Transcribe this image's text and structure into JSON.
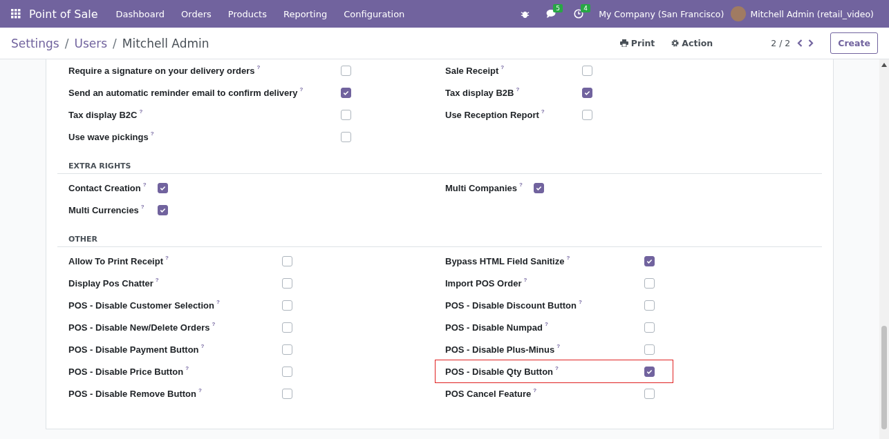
{
  "navbar": {
    "app_name": "Point of Sale",
    "menu": [
      "Dashboard",
      "Orders",
      "Products",
      "Reporting",
      "Configuration"
    ],
    "messages_count": "5",
    "activities_count": "4",
    "company": "My Company (San Francisco)",
    "user": "Mitchell Admin (retail_video)"
  },
  "control_panel": {
    "breadcrumbs": [
      "Settings",
      "Users",
      "Mitchell Admin"
    ],
    "separator": "/",
    "print": "Print",
    "action": "Action",
    "pager": "2 / 2",
    "create": "Create"
  },
  "sections": [
    {
      "left": [
        {
          "label": "Require a signature on your delivery orders",
          "checked": false,
          "highlighted": false
        },
        {
          "label": "Send an automatic reminder email to confirm delivery",
          "checked": true,
          "highlighted": false
        },
        {
          "label": "Tax display B2C",
          "checked": false,
          "highlighted": false
        },
        {
          "label": "Use wave pickings",
          "checked": false,
          "highlighted": false
        }
      ],
      "right": [
        {
          "label": "Sale Receipt",
          "checked": false,
          "highlighted": false
        },
        {
          "label": "Tax display B2B",
          "checked": true,
          "highlighted": false
        },
        {
          "label": "Use Reception Report",
          "checked": false,
          "highlighted": false
        }
      ]
    },
    {
      "title": "EXTRA RIGHTS",
      "left": [
        {
          "label": "Contact Creation",
          "checked": true,
          "highlighted": false
        },
        {
          "label": "Multi Currencies",
          "checked": true,
          "highlighted": false
        }
      ],
      "right": [
        {
          "label": "Multi Companies",
          "checked": true,
          "highlighted": false
        }
      ]
    },
    {
      "title": "OTHER",
      "left": [
        {
          "label": "Allow To Print Receipt",
          "checked": false,
          "highlighted": false
        },
        {
          "label": "Display Pos Chatter",
          "checked": false,
          "highlighted": false
        },
        {
          "label": "POS - Disable Customer Selection",
          "checked": false,
          "highlighted": false
        },
        {
          "label": "POS - Disable New/Delete Orders",
          "checked": false,
          "highlighted": false
        },
        {
          "label": "POS - Disable Payment Button",
          "checked": false,
          "highlighted": false
        },
        {
          "label": "POS - Disable Price Button",
          "checked": false,
          "highlighted": false
        },
        {
          "label": "POS - Disable Remove Button",
          "checked": false,
          "highlighted": false
        }
      ],
      "right": [
        {
          "label": "Bypass HTML Field Sanitize",
          "checked": true,
          "highlighted": false
        },
        {
          "label": "Import POS Order",
          "checked": false,
          "highlighted": false
        },
        {
          "label": "POS - Disable Discount Button",
          "checked": false,
          "highlighted": false
        },
        {
          "label": "POS - Disable Numpad",
          "checked": false,
          "highlighted": false
        },
        {
          "label": "POS - Disable Plus-Minus",
          "checked": false,
          "highlighted": false
        },
        {
          "label": "POS - Disable Qty Button",
          "checked": true,
          "highlighted": true
        },
        {
          "label": "POS Cancel Feature",
          "checked": false,
          "highlighted": false
        }
      ]
    }
  ],
  "help_mark": "?"
}
